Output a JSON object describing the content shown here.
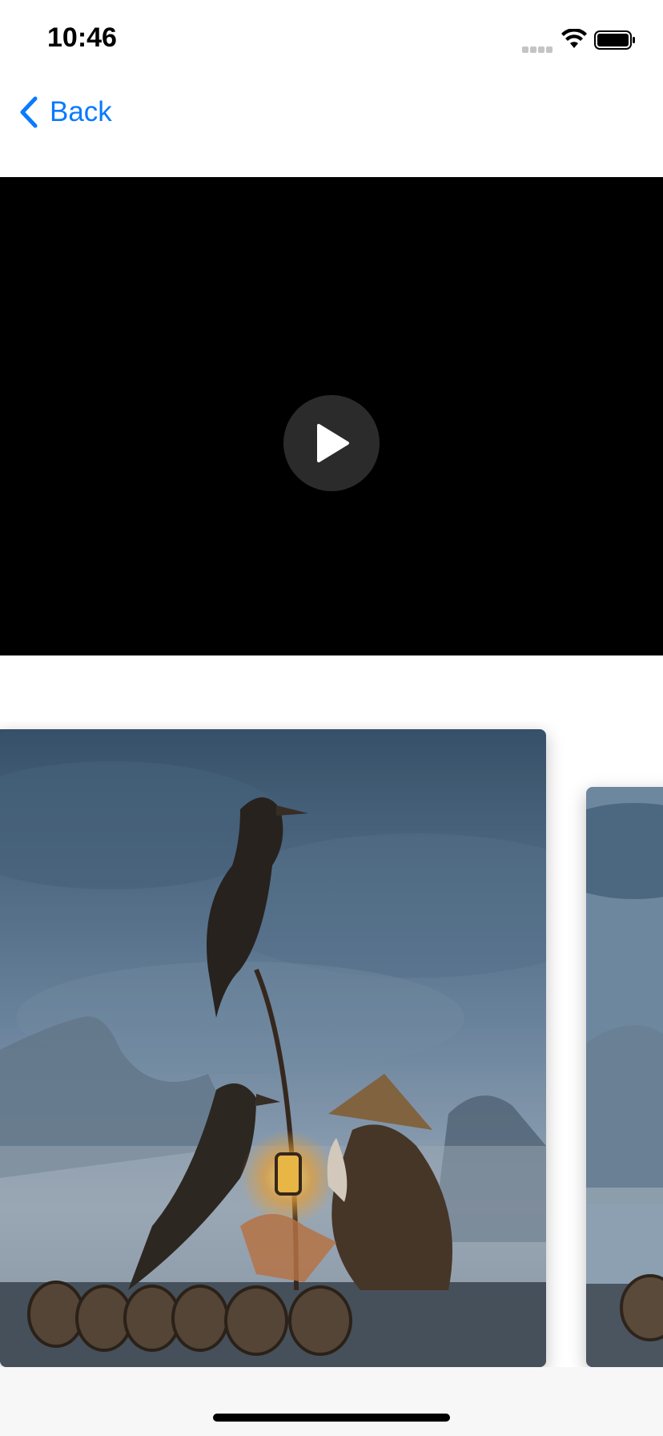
{
  "status_bar": {
    "time": "10:46",
    "icons": [
      "cellular-signal-icon",
      "wifi-icon",
      "battery-icon"
    ]
  },
  "nav": {
    "back_label": "Back",
    "back_icon": "chevron-left-icon",
    "accent_color": "#0a7aff"
  },
  "video": {
    "play_icon": "play-icon",
    "background": "#000000"
  },
  "carousel": {
    "items": [
      {
        "image": "fisherman-with-cormorants-photo"
      },
      {
        "image": "fisherman-with-cormorants-photo"
      }
    ]
  }
}
